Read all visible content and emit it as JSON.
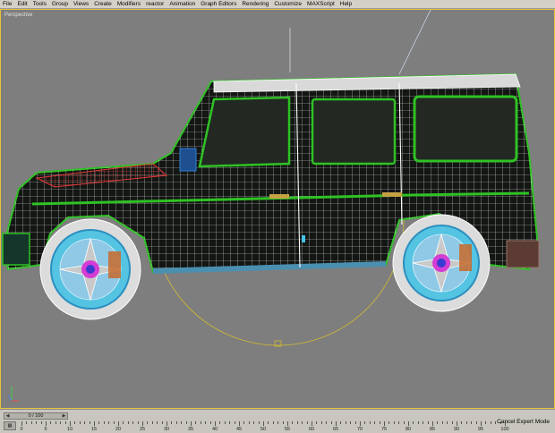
{
  "menubar": {
    "items": [
      "File",
      "Edit",
      "Tools",
      "Group",
      "Views",
      "Create",
      "Modifiers",
      "reactor",
      "Animation",
      "Graph Editors",
      "Rendering",
      "Customize",
      "MAXScript",
      "Help"
    ]
  },
  "viewport": {
    "label": "Perspective",
    "accent_color": "#e8c43a"
  },
  "timeline": {
    "slider_value": "0 / 100",
    "prev_icon": "arrow-left-icon",
    "next_icon": "arrow-right-icon",
    "ticks": [
      "0",
      "5",
      "10",
      "15",
      "20",
      "25",
      "30",
      "35",
      "40",
      "45",
      "50",
      "55",
      "60",
      "65",
      "70",
      "75",
      "80",
      "85",
      "90",
      "95",
      "100"
    ]
  },
  "status": {
    "expert_mode_label": "Cancel Expert Mode"
  }
}
